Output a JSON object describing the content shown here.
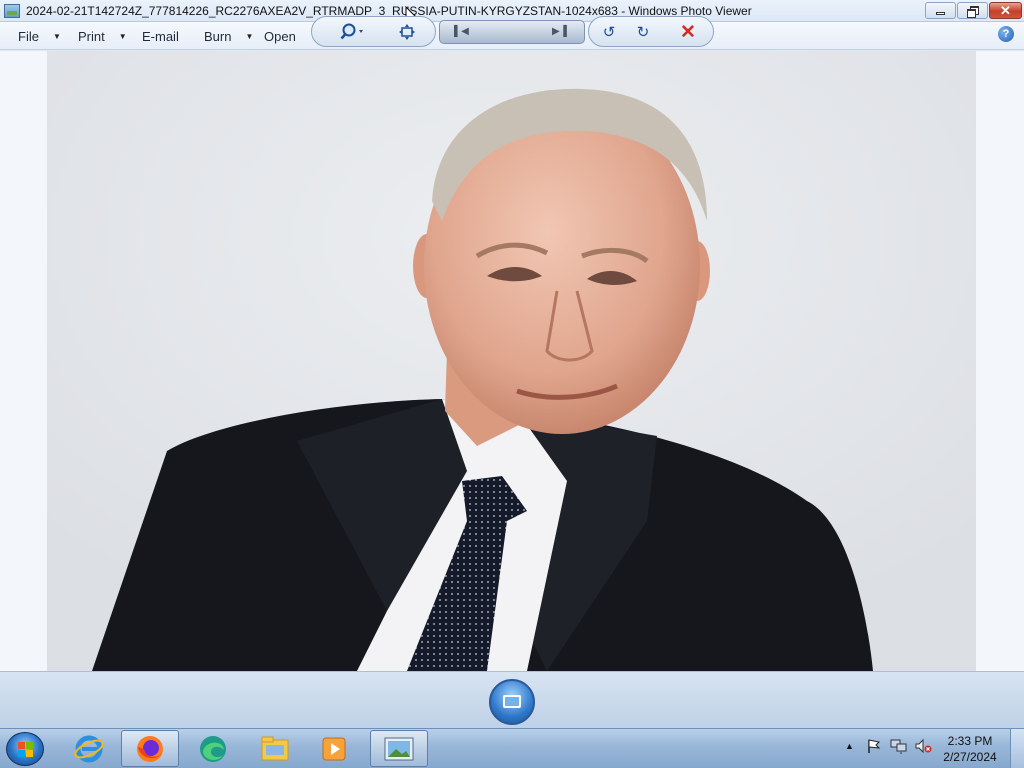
{
  "window": {
    "title": "2024-02-21T142724Z_777814226_RC2276AXEA2V_RTRMADP_3_RUSSIA-PUTIN-KYRGYZSTAN-1024x683 - Windows Photo Viewer",
    "icon": "photo-viewer-icon"
  },
  "title_buttons": {
    "minimize": "minimize-icon",
    "maximize": "restore-icon",
    "close": "close-icon"
  },
  "menu": {
    "items": [
      {
        "label": "File",
        "has_dropdown": true
      },
      {
        "label": "Print",
        "has_dropdown": true
      },
      {
        "label": "E-mail",
        "has_dropdown": false
      },
      {
        "label": "Burn",
        "has_dropdown": true
      },
      {
        "label": "Open",
        "has_dropdown": true
      }
    ],
    "help_icon": "help-icon",
    "help_glyph": "?"
  },
  "controls": {
    "zoom": "zoom-icon",
    "actual_size": "actual-size-icon",
    "previous": "previous-icon",
    "slideshow": "slideshow-icon",
    "next": "next-icon",
    "rotate_ccw": "rotate-counterclockwise-icon",
    "rotate_cw": "rotate-clockwise-icon",
    "delete": "delete-icon",
    "colors": {
      "delete": "#d42a24",
      "accent": "#1d4f93"
    }
  },
  "taskbar": {
    "start": "windows-start-icon",
    "apps": [
      {
        "name": "internet-explorer-icon",
        "active": false
      },
      {
        "name": "firefox-icon",
        "active": true
      },
      {
        "name": "edge-icon",
        "active": false
      },
      {
        "name": "file-explorer-icon",
        "active": false
      },
      {
        "name": "media-player-icon",
        "active": false
      },
      {
        "name": "photo-viewer-icon",
        "active": true
      }
    ],
    "tray": {
      "show_hidden": "show-hidden-icons-icon",
      "flag": "action-center-flag-icon",
      "network": "network-icon",
      "volume": "volume-muted-icon"
    },
    "time": "2:33 PM",
    "date": "2/27/2024"
  }
}
